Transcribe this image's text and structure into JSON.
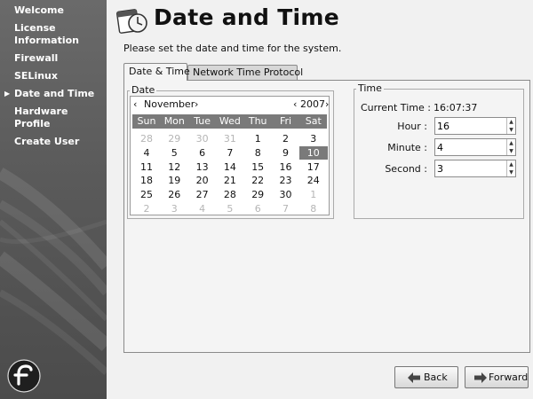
{
  "sidebar": {
    "items": [
      {
        "lines": [
          "Welcome"
        ],
        "active": false
      },
      {
        "lines": [
          "License",
          "Information"
        ],
        "active": false
      },
      {
        "lines": [
          "Firewall"
        ],
        "active": false
      },
      {
        "lines": [
          "SELinux"
        ],
        "active": false
      },
      {
        "lines": [
          "Date and Time"
        ],
        "active": true
      },
      {
        "lines": [
          "Hardware",
          "Profile"
        ],
        "active": false
      },
      {
        "lines": [
          "Create User"
        ],
        "active": false
      }
    ],
    "active_arrow": "▶"
  },
  "header": {
    "title": "Date and Time",
    "instructions": "Please set the date and time for the system."
  },
  "tabs": [
    {
      "label": "Date & Time",
      "active": true
    },
    {
      "label": "Network Time Protocol",
      "active": false
    }
  ],
  "date_section": {
    "label": "Date",
    "month": "November",
    "year": "2007",
    "prev_arrow": "‹",
    "next_arrow": "›",
    "weekdays": [
      "Sun",
      "Mon",
      "Tue",
      "Wed",
      "Thu",
      "Fri",
      "Sat"
    ],
    "weeks": [
      [
        {
          "d": "28",
          "other": true
        },
        {
          "d": "29",
          "other": true
        },
        {
          "d": "30",
          "other": true
        },
        {
          "d": "31",
          "other": true
        },
        {
          "d": "1"
        },
        {
          "d": "2"
        },
        {
          "d": "3"
        }
      ],
      [
        {
          "d": "4"
        },
        {
          "d": "5"
        },
        {
          "d": "6"
        },
        {
          "d": "7"
        },
        {
          "d": "8"
        },
        {
          "d": "9"
        },
        {
          "d": "10",
          "selected": true
        }
      ],
      [
        {
          "d": "11"
        },
        {
          "d": "12"
        },
        {
          "d": "13"
        },
        {
          "d": "14"
        },
        {
          "d": "15"
        },
        {
          "d": "16"
        },
        {
          "d": "17"
        }
      ],
      [
        {
          "d": "18"
        },
        {
          "d": "19"
        },
        {
          "d": "20"
        },
        {
          "d": "21"
        },
        {
          "d": "22"
        },
        {
          "d": "23"
        },
        {
          "d": "24"
        }
      ],
      [
        {
          "d": "25"
        },
        {
          "d": "26"
        },
        {
          "d": "27"
        },
        {
          "d": "28"
        },
        {
          "d": "29"
        },
        {
          "d": "30"
        },
        {
          "d": "1",
          "other": true
        }
      ],
      [
        {
          "d": "2",
          "other": true
        },
        {
          "d": "3",
          "other": true
        },
        {
          "d": "4",
          "other": true
        },
        {
          "d": "5",
          "other": true
        },
        {
          "d": "6",
          "other": true
        },
        {
          "d": "7",
          "other": true
        },
        {
          "d": "8",
          "other": true
        }
      ]
    ]
  },
  "time_section": {
    "label": "Time",
    "current_time_label": "Current Time :",
    "current_time_value": "16:07:37",
    "hour_label": "Hour :",
    "hour_value": "16",
    "minute_label": "Minute :",
    "minute_value": "4",
    "second_label": "Second :",
    "second_value": "3"
  },
  "buttons": {
    "back": "Back",
    "forward": "Forward"
  },
  "colors": {
    "sidebar": "#5a5a5a",
    "selected_day": "#7a7a7a",
    "weekday_header": "#7a7a7a"
  }
}
